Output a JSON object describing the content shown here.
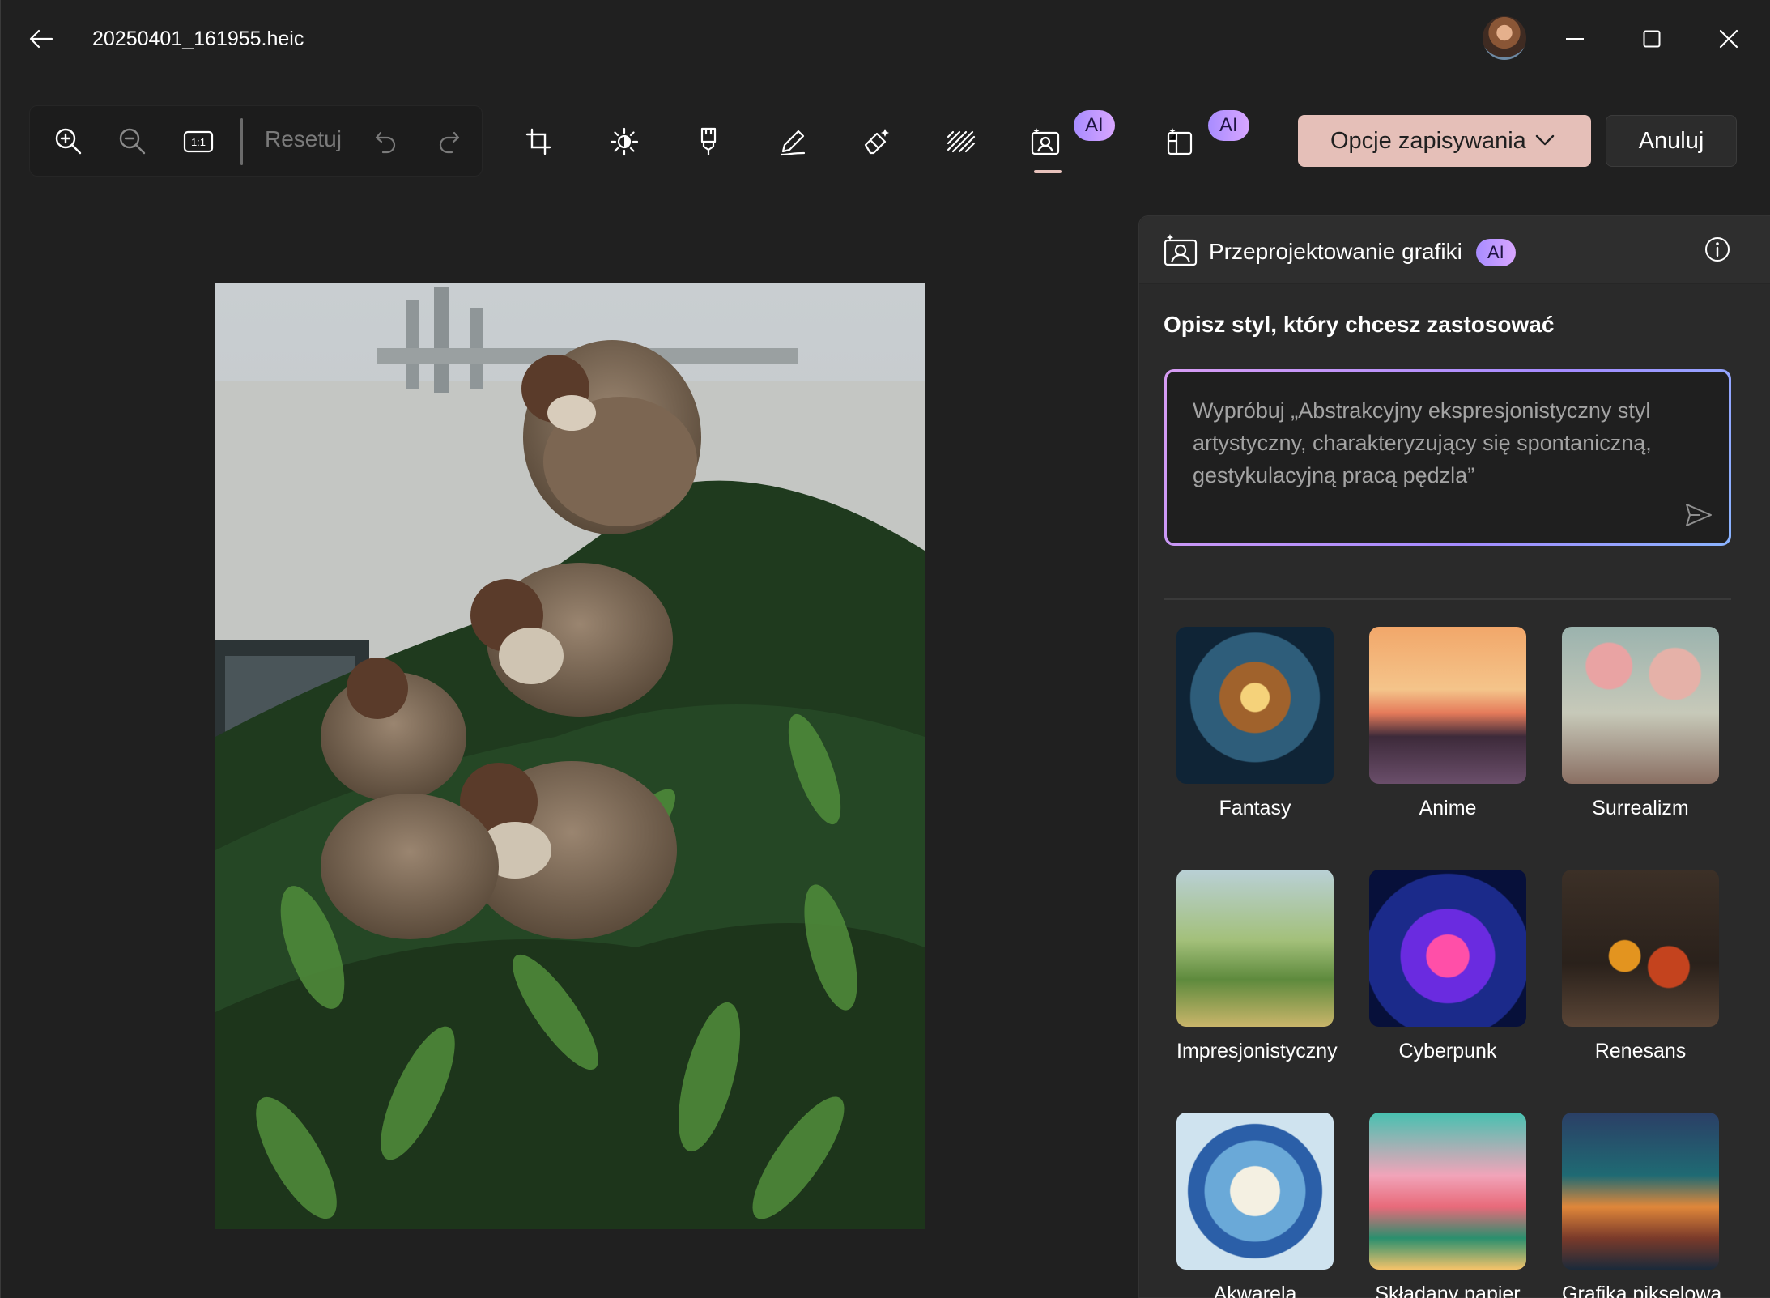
{
  "window": {
    "title": "20250401_161955.heic",
    "minimize_label": "",
    "maximize_label": "",
    "close_label": ""
  },
  "toolbar": {
    "reset_label": "Resetuj",
    "actual_size_label": "1:1",
    "ai_badge": "AI",
    "save_options_label": "Opcje zapisywania",
    "cancel_label": "Anuluj"
  },
  "panel": {
    "title": "Przeprojektowanie grafiki",
    "ai_badge": "AI",
    "prompt_heading": "Opisz styl, który chcesz zastosować",
    "prompt_placeholder": "Wypróbuj „Abstrakcyjny ekspresjonistyczny styl artystyczny, charakteryzujący się spontaniczną, gestykulacyjną pracą pędzla”",
    "styles": [
      {
        "label": "Fantasy"
      },
      {
        "label": "Anime"
      },
      {
        "label": "Surrealizm"
      },
      {
        "label": "Impresjonistyczny"
      },
      {
        "label": "Cyberpunk"
      },
      {
        "label": "Renesans"
      },
      {
        "label": "Akwarela"
      },
      {
        "label": "Składany papier"
      },
      {
        "label": "Grafika pikselowa"
      }
    ]
  },
  "colors": {
    "background": "#202020",
    "panel": "#2a2a2a",
    "accent_save": "#e5bfb8",
    "ai_badge": "#b79cff"
  }
}
